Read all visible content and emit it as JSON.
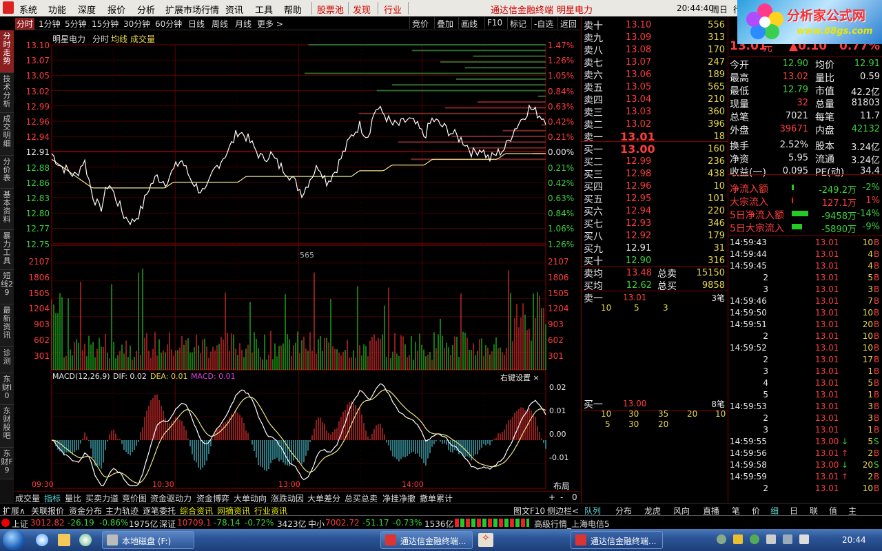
{
  "window": {
    "menu": [
      "系统",
      "功能",
      "深度",
      "报价",
      "分析",
      "扩展市场行情",
      "资讯",
      "工具",
      "帮助"
    ],
    "menu_red": [
      "股票池",
      "发现",
      "行业"
    ],
    "app_title": "通达信金融终端",
    "stock_title": "明星电力",
    "clock": "20:44:40",
    "weekday": "周日",
    "cut_label": "行",
    "logo_title": "分析家公式网",
    "logo_url": "www.88gs.com"
  },
  "period_tabs": [
    "分时",
    "1分钟",
    "5分钟",
    "15分钟",
    "30分钟",
    "60分钟",
    "日线",
    "周线",
    "月线",
    "更多 >"
  ],
  "tool_buttons": [
    "竞价",
    "叠加",
    "画线",
    "F10",
    "标记",
    "-自选",
    "返回"
  ],
  "left_tabs": [
    "分时走势",
    "技术分析",
    "成交明细",
    "分价表",
    "基本资料",
    "暴力工具",
    "短线29",
    "最新资讯",
    "诊测",
    "东财I0",
    "东财股吧",
    "东财F9"
  ],
  "chart_header": {
    "name": "明星电力",
    "mode": "分时",
    "avg_label": "均线",
    "vol_label": "成交量"
  },
  "price_axis": {
    "left": [
      "13.10",
      "13.07",
      "13.05",
      "13.02",
      "12.99",
      "12.96",
      "12.94",
      "12.91",
      "12.88",
      "12.86",
      "12.83",
      "12.80",
      "12.77",
      "12.75"
    ],
    "right": [
      "1.47%",
      "1.26%",
      "1.05%",
      "0.84%",
      "0.63%",
      "0.42%",
      "0.21%",
      "0.00%",
      "0.21%",
      "0.42%",
      "0.63%",
      "0.84%",
      "1.06%",
      "1.26%"
    ]
  },
  "volume_axis": [
    "2107",
    "1806",
    "1505",
    "1204",
    "903",
    "602",
    "301"
  ],
  "volume_peak_label": "565",
  "macd_header": {
    "title": "MACD(12,26,9)",
    "dif": "DIF: 0.02",
    "dea": "DEA: 0.01",
    "macd": "MACD: 0.01",
    "settings": "右键设置 ×"
  },
  "macd_axis": [
    "0.02",
    "0.01",
    "0.00",
    "-0.01"
  ],
  "time_axis": [
    "09:30",
    "10:30",
    "13:00",
    "14:00"
  ],
  "layout_btn": "布局",
  "bottom_tabs": [
    "成交量",
    "指标",
    "量比",
    "买卖力道",
    "竞价图",
    "资金驱动力",
    "资金博弈",
    "大单动向",
    "涨跌动因",
    "大单差分",
    "总买总卖",
    "净挂净撤",
    "撤单累计"
  ],
  "bottom_controls": [
    "+",
    "-",
    "0"
  ],
  "status_tabs": [
    "扩展∧",
    "关联报价",
    "资金分布",
    "主力轨迹",
    "逐笔委托",
    "综合资讯",
    "网摘资讯",
    "行业资讯"
  ],
  "status_right": [
    "图文F10",
    "侧边栏<"
  ],
  "order_book": {
    "sell": [
      {
        "label": "卖十",
        "price": "13.10",
        "vol": "556"
      },
      {
        "label": "卖九",
        "price": "13.09",
        "vol": "313"
      },
      {
        "label": "卖八",
        "price": "13.08",
        "vol": "170"
      },
      {
        "label": "卖七",
        "price": "13.07",
        "vol": "247"
      },
      {
        "label": "卖六",
        "price": "13.06",
        "vol": "189"
      },
      {
        "label": "卖五",
        "price": "13.05",
        "vol": "565"
      },
      {
        "label": "卖四",
        "price": "13.04",
        "vol": "210"
      },
      {
        "label": "卖三",
        "price": "13.03",
        "vol": "360"
      },
      {
        "label": "卖二",
        "price": "13.02",
        "vol": "396"
      },
      {
        "label": "卖一",
        "price": "13.01",
        "vol": "18"
      }
    ],
    "buy": [
      {
        "label": "买一",
        "price": "13.00",
        "vol": "160"
      },
      {
        "label": "买二",
        "price": "12.99",
        "vol": "236"
      },
      {
        "label": "买三",
        "price": "12.98",
        "vol": "438"
      },
      {
        "label": "买四",
        "price": "12.96",
        "vol": "10"
      },
      {
        "label": "买五",
        "price": "12.95",
        "vol": "101"
      },
      {
        "label": "买六",
        "price": "12.94",
        "vol": "220"
      },
      {
        "label": "买七",
        "price": "12.93",
        "vol": "346"
      },
      {
        "label": "买八",
        "price": "12.92",
        "vol": "179"
      },
      {
        "label": "买九",
        "price": "12.91",
        "vol": "31"
      },
      {
        "label": "买十",
        "price": "12.90",
        "vol": "316"
      }
    ],
    "sell_avg": {
      "label": "卖均",
      "price": "13.48",
      "total_label": "总卖",
      "total": "15150"
    },
    "buy_avg": {
      "label": "买均",
      "price": "12.62",
      "total_label": "总买",
      "total": "9858"
    },
    "queue_sell": {
      "label": "卖一",
      "price": "13.01",
      "count": "3笔",
      "orders": [
        "10",
        "5",
        "3"
      ]
    },
    "queue_buy": {
      "label": "买一",
      "price": "13.00",
      "count": "8笔",
      "orders1": [
        "10",
        "30",
        "35",
        "20",
        "10"
      ],
      "orders2": [
        "5",
        "30",
        "20"
      ]
    }
  },
  "right_tabs": [
    "队列",
    "分布",
    "龙虎",
    "风向",
    "直播"
  ],
  "quote": {
    "price": "13.01",
    "unit": "元",
    "change": "▲0.10",
    "pct": "0.77%",
    "rows": [
      [
        "今开",
        "12.90",
        "均价",
        "12.91"
      ],
      [
        "最高",
        "13.02",
        "量比",
        "0.59"
      ],
      [
        "最低",
        "12.79",
        "市值",
        "42.2亿"
      ],
      [
        "现量",
        "32",
        "总量",
        "81803"
      ],
      [
        "总笔",
        "7021",
        "每笔",
        "11.7"
      ],
      [
        "外盘",
        "39671",
        "内盘",
        "42132"
      ],
      [
        "换手",
        "2.52%",
        "股本",
        "3.24亿"
      ],
      [
        "净资",
        "5.95",
        "流通",
        "3.24亿"
      ],
      [
        "收益(一)",
        "0.095",
        "PE(动)",
        "34.4"
      ]
    ],
    "flows": [
      {
        "label": "净流入额",
        "value": "-249.2万",
        "pct": "-2%"
      },
      {
        "label": "大宗流入",
        "value": "127.1万",
        "pct": "1%"
      },
      {
        "label": "5日净流入额",
        "value": "-9458万",
        "pct": "-14%"
      },
      {
        "label": "5日大宗流入",
        "value": "-5890万",
        "pct": "-9%"
      }
    ]
  },
  "ticks": [
    {
      "t": "14:59:43",
      "p": "13.01",
      "v": "10",
      "d": "B",
      "a": ""
    },
    {
      "t": "14:59:44",
      "p": "13.01",
      "v": "4",
      "d": "B",
      "a": ""
    },
    {
      "t": "14:59:45",
      "p": "13.01",
      "v": "4",
      "d": "B",
      "a": ""
    },
    {
      "t": "2",
      "p": "13.01",
      "v": "5",
      "d": "B",
      "a": ""
    },
    {
      "t": "3",
      "p": "13.01",
      "v": "3",
      "d": "B",
      "a": ""
    },
    {
      "t": "14:59:46",
      "p": "13.01",
      "v": "7",
      "d": "B",
      "a": ""
    },
    {
      "t": "14:59:50",
      "p": "13.01",
      "v": "10",
      "d": "B",
      "a": ""
    },
    {
      "t": "14:59:51",
      "p": "13.01",
      "v": "20",
      "d": "B",
      "a": ""
    },
    {
      "t": "2",
      "p": "13.01",
      "v": "10",
      "d": "B",
      "a": ""
    },
    {
      "t": "14:59:52",
      "p": "13.01",
      "v": "10",
      "d": "B",
      "a": ""
    },
    {
      "t": "2",
      "p": "13.01",
      "v": "17",
      "d": "B",
      "a": ""
    },
    {
      "t": "3",
      "p": "13.01",
      "v": "1",
      "d": "B",
      "a": ""
    },
    {
      "t": "4",
      "p": "13.01",
      "v": "5",
      "d": "B",
      "a": ""
    },
    {
      "t": "5",
      "p": "13.01",
      "v": "1",
      "d": "B",
      "a": ""
    },
    {
      "t": "14:59:53",
      "p": "13.01",
      "v": "3",
      "d": "B",
      "a": ""
    },
    {
      "t": "2",
      "p": "13.01",
      "v": "3",
      "d": "B",
      "a": ""
    },
    {
      "t": "3",
      "p": "13.01",
      "v": "1",
      "d": "B",
      "a": ""
    },
    {
      "t": "14:59:55",
      "p": "13.00",
      "v": "5",
      "d": "S",
      "a": "↓"
    },
    {
      "t": "14:59:56",
      "p": "13.01",
      "v": "2",
      "d": "B",
      "a": "↑"
    },
    {
      "t": "14:59:58",
      "p": "13.00",
      "v": "20",
      "d": "S",
      "a": "↓"
    },
    {
      "t": "14:59:59",
      "p": "13.01",
      "v": "2",
      "d": "B",
      "a": "↑"
    },
    {
      "t": "2",
      "p": "13.01",
      "v": "10",
      "d": "B",
      "a": ""
    }
  ],
  "far_tabs": [
    "笔",
    "价",
    "细",
    "日",
    "联",
    "值",
    "主"
  ],
  "indices": {
    "sh_label": "上证",
    "sh": "3012.82",
    "sh_chg": "-26.19",
    "sh_pct": "-0.86%",
    "sh_amt": "1975亿",
    "sz_label": "深证",
    "sz": "10709.1",
    "sz_chg": "-78.14",
    "sz_pct": "-0.72%",
    "sz_amt": "3423亿",
    "zx_label": "中小",
    "zx": "7002.72",
    "zx_chg": "-51.17",
    "zx_pct": "-0.73%",
    "zx_amt": "1536亿",
    "feed": "高级行情_上海电信5"
  },
  "taskbar": {
    "items": [
      "本地磁盘 (F:)",
      "通达信金融终端...",
      "通达信金融终端..."
    ],
    "time": "20:44"
  },
  "chart_data": [
    {
      "type": "line",
      "title": "明星电力 分时",
      "series": [
        {
          "name": "price",
          "values": [
            12.91,
            12.89,
            12.88,
            12.87,
            12.9,
            12.84,
            12.81,
            12.86,
            12.83,
            12.8,
            12.79,
            12.81,
            12.85,
            12.87,
            12.86,
            12.88,
            12.9,
            12.87,
            12.85,
            12.84,
            12.88,
            12.9,
            12.92,
            12.95,
            12.94,
            12.92,
            12.9,
            12.91,
            12.89,
            12.88,
            12.86,
            12.84,
            12.87,
            12.89,
            12.86,
            12.88,
            12.91,
            12.94,
            12.96,
            12.94,
            12.99,
            12.98,
            12.96,
            12.96,
            12.97,
            12.96,
            12.94,
            12.97,
            12.96,
            12.95,
            12.94,
            12.93,
            12.91,
            12.92,
            12.9,
            12.91,
            12.92,
            12.95,
            12.97,
            12.99,
            12.98,
            12.97
          ]
        },
        {
          "name": "均线",
          "values": [
            12.9,
            12.89,
            12.88,
            12.87,
            12.86,
            12.85,
            12.85,
            12.85,
            12.85,
            12.85,
            12.85,
            12.85,
            12.85,
            12.85,
            12.85,
            12.86,
            12.86,
            12.86,
            12.86,
            12.86,
            12.86,
            12.86,
            12.86,
            12.86,
            12.87,
            12.87,
            12.87,
            12.87,
            12.87,
            12.87,
            12.87,
            12.87,
            12.87,
            12.87,
            12.87,
            12.87,
            12.87,
            12.87,
            12.88,
            12.88,
            12.88,
            12.88,
            12.89,
            12.89,
            12.89,
            12.89,
            12.89,
            12.9,
            12.9,
            12.9,
            12.9,
            12.9,
            12.9,
            12.9,
            12.9,
            12.9,
            12.91,
            12.91,
            12.91,
            12.91,
            12.91,
            12.91
          ]
        }
      ],
      "ylim": [
        12.75,
        13.1
      ]
    }
  ]
}
